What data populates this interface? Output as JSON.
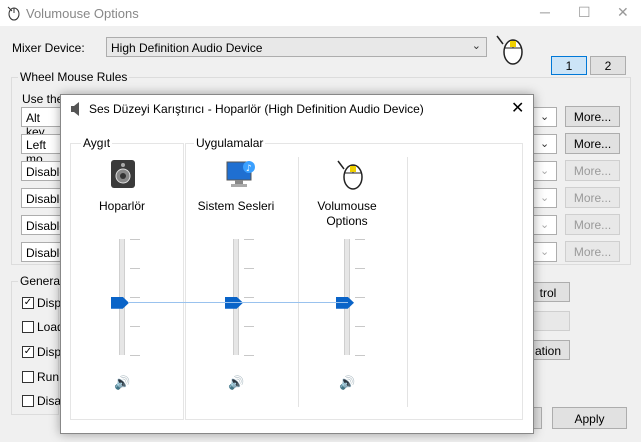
{
  "bg": {
    "title": "Volumouse Options",
    "mixer_label": "Mixer Device:",
    "mixer_value": "High Definition Audio Device",
    "tab1": "1",
    "tab2": "2",
    "wheel_group": "Wheel Mouse Rules",
    "use_the": "Use the",
    "rules": [
      "Alt key",
      "Left mo",
      "Disable",
      "Disable",
      "Disable",
      "Disable"
    ],
    "more": "More...",
    "general_group": "General",
    "general_items": [
      "Displ",
      "Load",
      "Displ",
      "Run",
      "Disal"
    ],
    "general_checked": [
      true,
      false,
      true,
      false,
      false
    ],
    "btn_trol": "trol",
    "btn_ation": "ation",
    "apply": "Apply"
  },
  "dialog": {
    "title": "Ses Düzeyi Karıştırıcı - Hoparlör (High Definition Audio Device)",
    "device_group": "Aygıt",
    "apps_group": "Uygulamalar",
    "channels": [
      {
        "name": "Hoparlör",
        "level": 0.45
      },
      {
        "name": "Sistem Sesleri",
        "level": 0.45
      },
      {
        "name": "Volumouse Options",
        "level": 0.45
      }
    ],
    "colors": {
      "accent": "#0a64c8"
    }
  }
}
